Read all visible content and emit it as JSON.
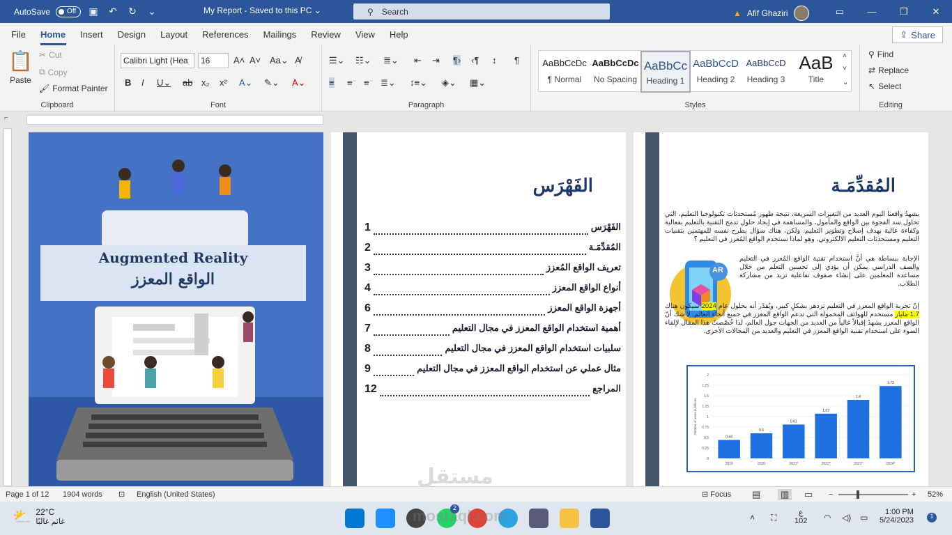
{
  "titlebar": {
    "autosave": "AutoSave",
    "toggle": "Off",
    "doc": "My Report  -  Saved to this PC  ⌄",
    "search": "Search",
    "user": "Afif Ghaziri"
  },
  "menu": {
    "tabs": [
      "File",
      "Home",
      "Insert",
      "Design",
      "Layout",
      "References",
      "Mailings",
      "Review",
      "View",
      "Help"
    ],
    "share": "Share"
  },
  "ribbon": {
    "clipboard": {
      "paste": "Paste",
      "cut": "Cut",
      "copy": "Copy",
      "painter": "Format Painter",
      "label": "Clipboard"
    },
    "font": {
      "name": "Calibri Light (Hea",
      "size": "16",
      "label": "Font"
    },
    "paragraph": {
      "label": "Paragraph"
    },
    "styles": {
      "label": "Styles",
      "items": [
        {
          "preview": "AaBbCcDc",
          "name": "¶ Normal"
        },
        {
          "preview": "AaBbCcDc",
          "name": "No Spacing"
        },
        {
          "preview": "AaBbCc",
          "name": "Heading 1"
        },
        {
          "preview": "AaBbCcD",
          "name": "Heading 2"
        },
        {
          "preview": "AaBbCcD",
          "name": "Heading 3"
        },
        {
          "preview": "AaB",
          "name": "Title"
        }
      ]
    },
    "editing": {
      "find": "Find",
      "replace": "Replace",
      "select": "Select",
      "label": "Editing"
    }
  },
  "page1": {
    "banner_en": "Augmented Reality",
    "banner_ar": "الواقع المعزز"
  },
  "page2": {
    "title": "الفَهْرَس",
    "toc": [
      {
        "label": "الفَهْرَس",
        "page": "1"
      },
      {
        "label": "المُقدِّمَـة",
        "page": "2"
      },
      {
        "label": "تعريف الواقع المُعزز",
        "page": "3"
      },
      {
        "label": "أنواع الواقع المعزز",
        "page": "4"
      },
      {
        "label": "أجهزة الواقع المعزز",
        "page": "6"
      },
      {
        "label": "أهمية استخدام الواقع المعزز في مجال التعليم",
        "page": "7"
      },
      {
        "label": "سلبيات استخدام الواقع المعزز في مجال التعليم",
        "page": "8"
      },
      {
        "label": "مثال عملي عن استخدام الواقع المعزز في مجال التعليم",
        "page": "9"
      },
      {
        "label": "المراجع",
        "page": "12"
      }
    ]
  },
  "page3": {
    "title": "المُقدِّمَـة",
    "p1": "يشهدُ واقعنا اليوم العديد من التغيرات السريعة، نتيجة ظهور مُستحدثات تكنولوجيا التعليم، التي تحاول سد الفجوة بين الواقع والمأمول، والمساهمة في إيجاد حلول تدمج التقنية بالتعليم بفعالية وكفاءة عالية بهدف إصلاح وتطوير التعليم. ولكن، هناك سؤال يطرح نفسه للمهتمين بتقنيات التعليم ومستحدثات التعليم الالكتروني، وهو لماذا نستخدم الواقع المُعزز في التعليم ؟",
    "p2": "الإجابة ببساطة هي أنَّ استخدام تقنية الواقع المُعزز في التعليم والصف الدراسي يمكن أن يؤدي إلى تحسين التعلم من خلال مساعدة المعلمين على إنشاء صفوف تفاعلية تزيد من مشاركة الطلاب.",
    "p3a": "إنّ تجربة الواقع المعزز في التعليم تزدهر بشكلٍ كبير، ويُقدّر أنه بحلول عام ",
    "year": "2024",
    "p3b": " سيكون هناك ",
    "count": "1.7 مليار",
    "p3c": " مستخدم للهواتف المحمولة التي تدعم الواقع المعزز في جميع أنحاء العالم. لا شك أنّ الواقع المعزز يشهدُ إقبالاً عالياً من العديد من الجهات حول العالم، لذا خُصّصتُ هذا المقال لإلقاء الضوء على استخدام تقنية الواقع المعزز في التعليم والعديد من المجالات الأخرى.",
    "ar_badge": "AR"
  },
  "chart_data": {
    "type": "bar",
    "categories": [
      "2019",
      "2020",
      "2021*",
      "2022*",
      "2023*",
      "2024*"
    ],
    "values": [
      0.44,
      0.6,
      0.81,
      1.07,
      1.4,
      1.73
    ],
    "data_labels": [
      "0.44",
      "0.6",
      "0.81",
      "1.07",
      "1.4",
      "1.73"
    ],
    "ylim": [
      0,
      2
    ],
    "yticks": [
      "0",
      "0.25",
      "0.5",
      "0.75",
      "1",
      "1.25",
      "1.5",
      "1.75",
      "2"
    ],
    "ylabel": "Number of users in billions",
    "color": "#1e6fe0"
  },
  "status": {
    "page": "Page 1 of 12",
    "words": "1904 words",
    "lang": "English (United States)",
    "focus": "Focus",
    "zoom": "52%"
  },
  "taskbar": {
    "temp": "22°C",
    "weather": "غائم غالبًا",
    "lang": "ع",
    "lang2": "102",
    "time": "1:00 PM",
    "date": "5/24/2023",
    "badge": "2",
    "notif": "1"
  },
  "watermark": {
    "ar": "مستقل",
    "url": "mostaql.com"
  },
  "colors": {
    "accent": "#2b579a",
    "band": "#44546a",
    "cover": "#4472c4"
  }
}
